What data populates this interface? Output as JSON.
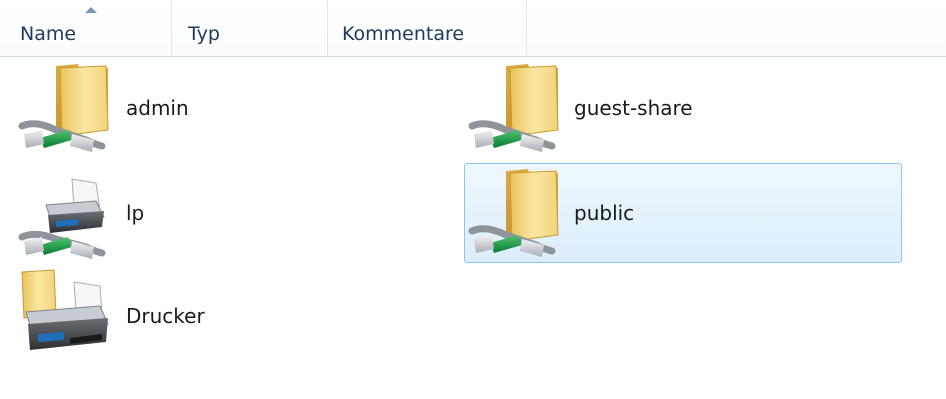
{
  "columns": {
    "name": "Name",
    "typ": "Typ",
    "kommentar": "Kommentare"
  },
  "items": [
    {
      "label": "admin",
      "kind": "network-folder"
    },
    {
      "label": "guest-share",
      "kind": "network-folder"
    },
    {
      "label": "lp",
      "kind": "network-printer"
    },
    {
      "label": "public",
      "kind": "network-folder",
      "selected": true
    },
    {
      "label": "Drucker",
      "kind": "printers-folder"
    }
  ],
  "colors": {
    "selection_fill": "#dceefb",
    "selection_border": "#8bc6ee",
    "header_text": "#1e395b",
    "folder": "#f1d57e",
    "network_cable": "#1fa04a"
  }
}
